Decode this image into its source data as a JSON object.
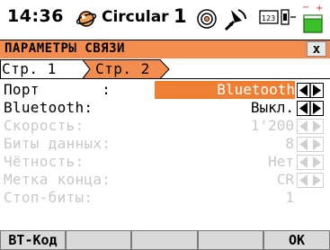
{
  "status_bar": {
    "time": "14:36",
    "mode": "Circular",
    "count": "1",
    "icons": [
      "satellite-icon",
      "target-icon",
      "comm-icon",
      "keyboard-123-icon",
      "battery-icon"
    ]
  },
  "title": {
    "text": "ПАРАМЕТРЫ СВЯЗИ",
    "close_label": "x"
  },
  "tabs": [
    {
      "label": "Стр. 1",
      "active": false
    },
    {
      "label": "Стр. 2",
      "active": true
    }
  ],
  "rows": [
    {
      "label": "Порт       :",
      "value": "Bluetooth",
      "enabled": true,
      "highlighted": true
    },
    {
      "label": "Bluetooth:",
      "value": "Выкл.",
      "enabled": true,
      "highlighted": false
    },
    {
      "label": "Скорость:",
      "value": "1'200",
      "enabled": false,
      "highlighted": false
    },
    {
      "label": "Биты данных:",
      "value": "8",
      "enabled": false,
      "highlighted": false
    },
    {
      "label": "Чётность:",
      "value": "Нет",
      "enabled": false,
      "highlighted": false
    },
    {
      "label": "Метка конца:",
      "value": "CR",
      "enabled": false,
      "highlighted": false
    },
    {
      "label": "Стоп-биты:",
      "value": "1",
      "enabled": false,
      "highlighted": false
    }
  ],
  "buttons": {
    "f1": "BT-Код",
    "f2": "",
    "f3": "",
    "f4": "",
    "f5": "OK"
  },
  "colors": {
    "accent": "#ef7f33",
    "title_bar": "#f28d4f",
    "disabled_text": "#c8c8c8",
    "battery_green": "#3bbf2b"
  }
}
